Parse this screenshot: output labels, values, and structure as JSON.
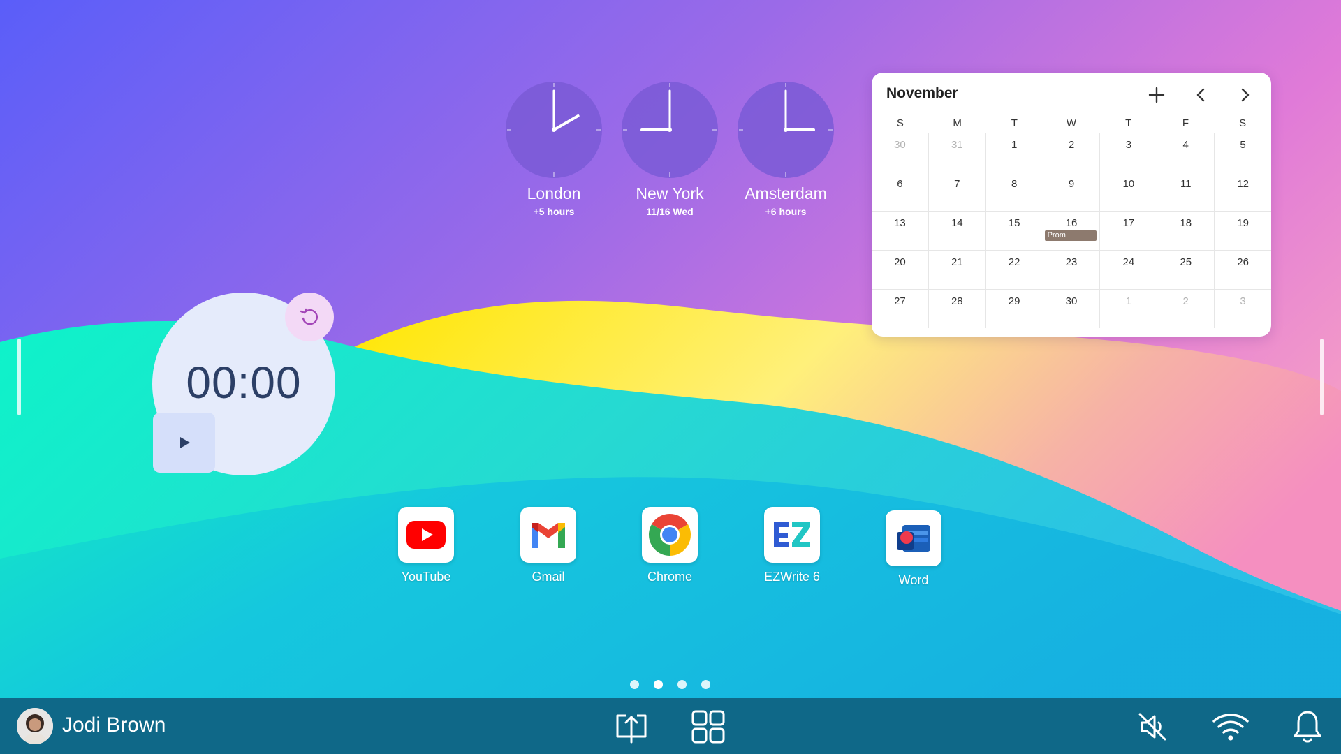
{
  "clocks": [
    {
      "city": "London",
      "sub": "+5 hours",
      "hour": 2,
      "minute": 0
    },
    {
      "city": "New York",
      "sub": "11/16 Wed",
      "hour": 9,
      "minute": 0
    },
    {
      "city": "Amsterdam",
      "sub": "+6 hours",
      "hour": 3,
      "minute": 0
    }
  ],
  "calendar": {
    "month": "November",
    "days_of_week": [
      "S",
      "M",
      "T",
      "W",
      "T",
      "F",
      "S"
    ],
    "weeks": [
      [
        "30",
        "31",
        "1",
        "2",
        "3",
        "4",
        "5"
      ],
      [
        "6",
        "7",
        "8",
        "9",
        "10",
        "11",
        "12"
      ],
      [
        "13",
        "14",
        "15",
        "16",
        "17",
        "18",
        "19"
      ],
      [
        "20",
        "21",
        "22",
        "23",
        "24",
        "25",
        "26"
      ],
      [
        "27",
        "28",
        "29",
        "30",
        "1",
        "2",
        "3"
      ]
    ],
    "muted": [
      [
        0,
        0
      ],
      [
        0,
        1
      ],
      [
        4,
        4
      ],
      [
        4,
        5
      ],
      [
        4,
        6
      ]
    ],
    "events": [
      {
        "week": 2,
        "day": 3,
        "label": "Prom"
      }
    ]
  },
  "timer": {
    "display": "00:00"
  },
  "apps": [
    {
      "name": "YouTube",
      "icon": "youtube-icon"
    },
    {
      "name": "Gmail",
      "icon": "gmail-icon"
    },
    {
      "name": "Chrome",
      "icon": "chrome-icon"
    },
    {
      "name": "EZWrite 6",
      "icon": "ezwrite-icon"
    },
    {
      "name": "Word",
      "icon": "word-icon"
    }
  ],
  "pages": {
    "count": 4,
    "current": 1
  },
  "taskbar": {
    "user_name": "Jodi Brown"
  },
  "colors": {
    "taskbar": "#0f6888",
    "timer_text": "#2c3f66",
    "event_chip": "#8d7a6e"
  }
}
